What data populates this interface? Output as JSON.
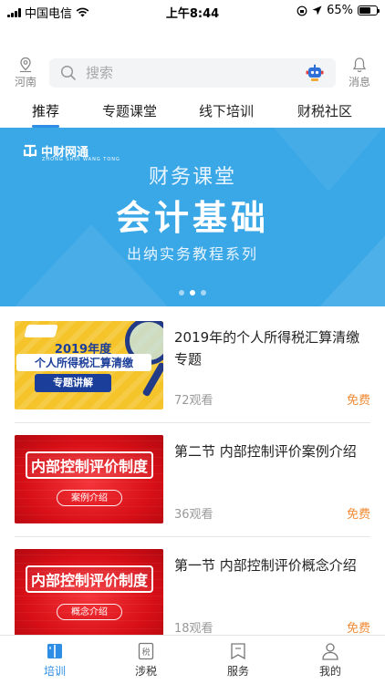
{
  "status_bar": {
    "carrier": "中国电信",
    "time": "上午8:44",
    "battery": "65%",
    "battery_level": 0.65
  },
  "header": {
    "location": "河南",
    "search_placeholder": "搜索",
    "message": "消息"
  },
  "tabs": [
    {
      "label": "推荐",
      "active": true
    },
    {
      "label": "专题课堂",
      "active": false
    },
    {
      "label": "线下培训",
      "active": false
    },
    {
      "label": "财税社区",
      "active": false
    }
  ],
  "banner": {
    "logo_text": "中财网通",
    "logo_sub": "ZHONG SHUI WANG TONG",
    "subtitle": "财务课堂",
    "title": "会计基础",
    "caption": "出纳实务教程系列",
    "page_count": 3,
    "active_page": 2,
    "color": "#3aa7e6"
  },
  "courses": [
    {
      "title": "2019年的个人所得税汇算清缴专题",
      "views": "72观看",
      "price": "免费",
      "thumb": {
        "style": "yellow",
        "line1": "2019年度",
        "line2": "个人所得税汇算清缴",
        "tag": "专题讲解"
      }
    },
    {
      "title": "第二节 内部控制评价案例介绍",
      "views": "36观看",
      "price": "免费",
      "thumb": {
        "style": "red",
        "line1": "内部控制评价制度",
        "tag": "案例介绍"
      }
    },
    {
      "title": "第一节 内部控制评价概念介绍",
      "views": "18观看",
      "price": "免费",
      "thumb": {
        "style": "red",
        "line1": "内部控制评价制度",
        "tag": "概念介绍"
      }
    }
  ],
  "tabbar": [
    {
      "label": "培训",
      "icon": "book-icon",
      "active": true
    },
    {
      "label": "涉税",
      "icon": "tax-icon",
      "active": false
    },
    {
      "label": "服务",
      "icon": "bookmark-icon",
      "active": false
    },
    {
      "label": "我的",
      "icon": "person-icon",
      "active": false
    }
  ],
  "colors": {
    "accent": "#2e8de4",
    "price": "#f08a35",
    "banner": "#3aa7e6"
  }
}
